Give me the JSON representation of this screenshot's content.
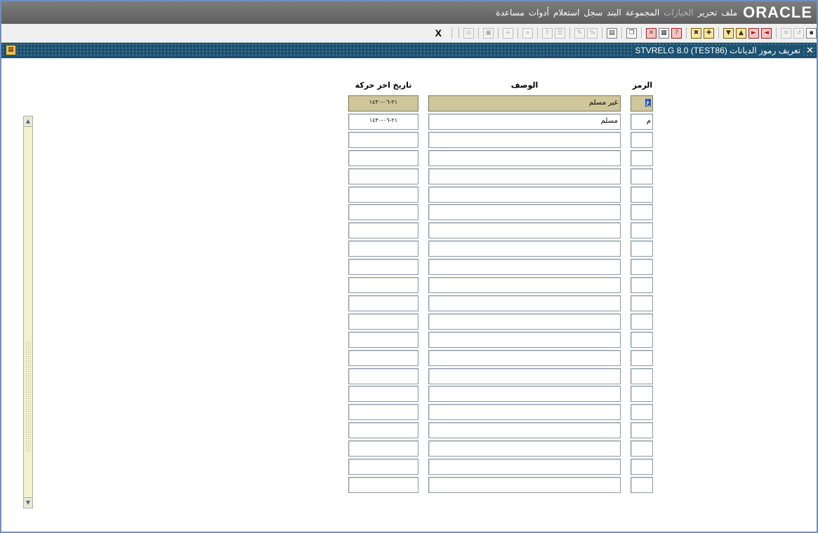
{
  "menubar": {
    "logo": "ORACLE",
    "items": [
      {
        "label": "ملف",
        "enabled": true
      },
      {
        "label": "تحرير",
        "enabled": true
      },
      {
        "label": "الخيارات",
        "enabled": false
      },
      {
        "label": "المجموعة",
        "enabled": true
      },
      {
        "label": "البند",
        "enabled": true
      },
      {
        "label": "سجل",
        "enabled": true
      },
      {
        "label": "استعلام",
        "enabled": true
      },
      {
        "label": "أدوات",
        "enabled": true
      },
      {
        "label": "مساعدة",
        "enabled": true
      }
    ]
  },
  "toolbar": {
    "exit_label": "X",
    "buttons": [
      {
        "name": "save-icon",
        "style": "normal"
      },
      {
        "name": "rollback-icon",
        "style": "dim"
      },
      {
        "name": "print-icon",
        "style": "dim"
      },
      {
        "name": "sep"
      },
      {
        "name": "previous-block-icon",
        "style": "red"
      },
      {
        "name": "next-block-icon",
        "style": "red"
      },
      {
        "name": "previous-record-icon",
        "style": "col"
      },
      {
        "name": "next-record-icon",
        "style": "col"
      },
      {
        "name": "sep"
      },
      {
        "name": "insert-record-icon",
        "style": "col"
      },
      {
        "name": "remove-record-icon",
        "style": "col"
      },
      {
        "name": "sep"
      },
      {
        "name": "enter-query-icon",
        "style": "red"
      },
      {
        "name": "execute-query-icon",
        "style": "normal"
      },
      {
        "name": "cancel-query-icon",
        "style": "red"
      },
      {
        "name": "sep"
      },
      {
        "name": "copy-icon",
        "style": "normal"
      },
      {
        "name": "sep"
      },
      {
        "name": "duplicate-icon",
        "style": "normal"
      },
      {
        "name": "sep"
      },
      {
        "name": "list-values-icon",
        "style": "dim"
      },
      {
        "name": "edit-icon",
        "style": "dim"
      },
      {
        "name": "sep"
      },
      {
        "name": "options-icon",
        "style": "dim"
      },
      {
        "name": "export-icon",
        "style": "dim"
      },
      {
        "name": "sep"
      },
      {
        "name": "navigate-back-icon",
        "style": "dim"
      },
      {
        "name": "sep"
      },
      {
        "name": "crosshair-icon",
        "style": "dim"
      },
      {
        "name": "sep"
      },
      {
        "name": "calendar-icon",
        "style": "dim"
      },
      {
        "name": "sep"
      },
      {
        "name": "help-icon",
        "style": "dim"
      },
      {
        "name": "sep"
      },
      {
        "name": "sep"
      }
    ]
  },
  "window": {
    "title": "تعريف رموز الديانات  STVRELG  8.0  (TEST86)",
    "close_label": "✕"
  },
  "grid": {
    "headers": {
      "code": "الرمز",
      "description": "الوصف",
      "activity_date": "تاريخ اخر حركة"
    },
    "rows": [
      {
        "code": "غ",
        "description": "غير مسلم",
        "date": "٢١-٠٦-١٤٣٠",
        "selected": true
      },
      {
        "code": "م",
        "description": "مسلم",
        "date": "٢١-٠٦-١٤٣٠",
        "selected": false
      }
    ],
    "total_rows": 22
  },
  "colors": {
    "menubar": "#6e6e6e",
    "titlebar": "#1c5170",
    "selected_row": "#cfc79a",
    "cursor": "#2050c0"
  }
}
